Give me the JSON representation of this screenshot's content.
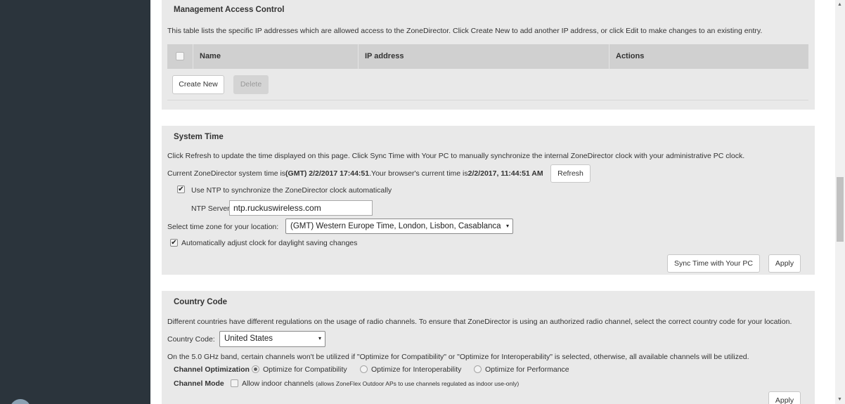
{
  "management_access": {
    "title": "Management Access Control",
    "description": "This table lists the specific IP addresses which are allowed access to the ZoneDirector. Click Create New to add another IP address, or click Edit to make changes to an existing entry.",
    "columns": [
      "Name",
      "IP address",
      "Actions"
    ],
    "create_new_label": "Create New",
    "delete_label": "Delete"
  },
  "system_time": {
    "title": "System Time",
    "description": "Click Refresh to update the time displayed on this page. Click Sync Time with Your PC to manually synchronize the internal ZoneDirector clock with your administrative PC clock.",
    "current_prefix": "Current ZoneDirector system time is",
    "current_time": "(GMT) 2/2/2017 17:44:51",
    "browser_prefix": ".Your browser's current time is",
    "browser_time": "2/2/2017, 11:44:51 AM",
    "refresh_label": "Refresh",
    "ntp_checkbox_label": "Use NTP to synchronize the ZoneDirector clock automatically",
    "ntp_checked": true,
    "ntp_server_label": "NTP Server*",
    "ntp_server_value": "ntp.ruckuswireless.com",
    "timezone_label": "Select time zone for your location:",
    "timezone_value": "(GMT) Western Europe Time, London, Lisbon, Casablanca",
    "dst_label": "Automatically adjust clock for daylight saving changes",
    "dst_checked": true,
    "sync_label": "Sync Time with Your PC",
    "apply_label": "Apply"
  },
  "country_code": {
    "title": "Country Code",
    "description": "Different countries have different regulations on the usage of radio channels. To ensure that ZoneDirector is using an authorized radio channel, select the correct country code for your location.",
    "country_label": "Country Code:",
    "country_value": "United States",
    "band_note": "On the 5.0 GHz band, certain channels won't be utilized if \"Optimize for Compatibility\" or \"Optimize for Interoperability\" is selected, otherwise, all available channels will be utilized.",
    "channel_optimization_label": "Channel Optimization",
    "optimization_options": [
      "Optimize for Compatibility",
      "Optimize for Interoperability",
      "Optimize for Performance"
    ],
    "optimization_selected": "Optimize for Compatibility",
    "channel_mode_label": "Channel Mode",
    "indoor_label": "Allow indoor channels",
    "indoor_note": "(allows ZoneFlex Outdoor APs to use channels regulated as indoor use-only)",
    "apply_label": "Apply"
  },
  "icons": {
    "select_arrow": "▾",
    "check": "✔",
    "scroll_up": "▲",
    "scroll_down": "▼"
  }
}
